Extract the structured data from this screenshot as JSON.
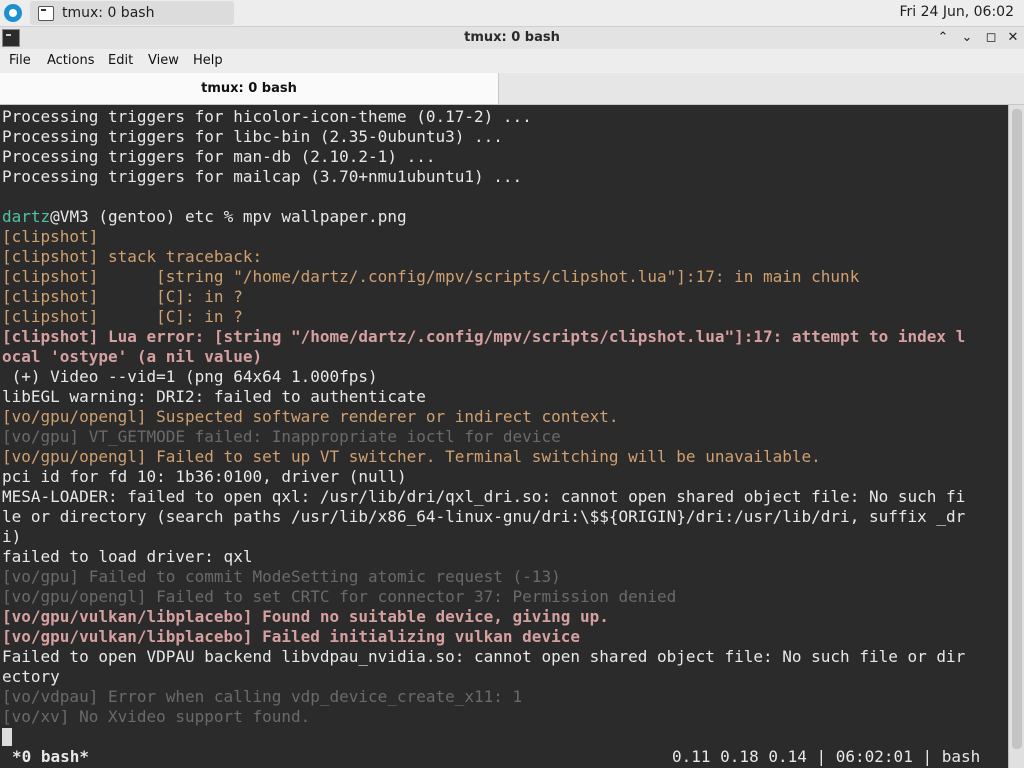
{
  "panel": {
    "task_label": "tmux: 0 bash",
    "clock": "Fri 24 Jun, 06:02"
  },
  "window": {
    "title": "tmux: 0 bash",
    "buttons": [
      "^",
      "v",
      "□",
      "×"
    ]
  },
  "menu": [
    "File",
    "Actions",
    "Edit",
    "View",
    "Help"
  ],
  "tab": {
    "label": "tmux: 0 bash"
  },
  "terminal": {
    "lines": [
      {
        "text": "Processing triggers for hicolor-icon-theme (0.17-2) ...",
        "style": "normal"
      },
      {
        "text": "Processing triggers for libc-bin (2.35-0ubuntu3) ...",
        "style": "normal"
      },
      {
        "text": "Processing triggers for man-db (2.10.2-1) ...",
        "style": "normal"
      },
      {
        "text": "Processing triggers for mailcap (3.70+nmu1ubuntu1) ...",
        "style": "normal"
      },
      {
        "text": "",
        "style": "normal"
      },
      {
        "prompt_user": "dartz",
        "text": "@VM3 (gentoo) etc % mpv wallpaper.png",
        "style": "prompt"
      },
      {
        "text": "[clipshot]",
        "style": "warn"
      },
      {
        "text": "[clipshot] stack traceback:",
        "style": "warn"
      },
      {
        "text": "[clipshot]      [string \"/home/dartz/.config/mpv/scripts/clipshot.lua\"]:17: in main chunk",
        "style": "warn"
      },
      {
        "text": "[clipshot]      [C]: in ?",
        "style": "warn"
      },
      {
        "text": "[clipshot]      [C]: in ?",
        "style": "warn"
      },
      {
        "text": "[clipshot] Lua error: [string \"/home/dartz/.config/mpv/scripts/clipshot.lua\"]:17: attempt to index l",
        "style": "err"
      },
      {
        "text": "ocal 'ostype' (a nil value)",
        "style": "err"
      },
      {
        "text": " (+) Video --vid=1 (png 64x64 1.000fps)",
        "style": "normal"
      },
      {
        "text": "libEGL warning: DRI2: failed to authenticate",
        "style": "normal"
      },
      {
        "text": "[vo/gpu/opengl] Suspected software renderer or indirect context.",
        "style": "warn"
      },
      {
        "text": "[vo/gpu] VT_GETMODE failed: Inappropriate ioctl for device",
        "style": "dim"
      },
      {
        "text": "[vo/gpu/opengl] Failed to set up VT switcher. Terminal switching will be unavailable.",
        "style": "warn"
      },
      {
        "text": "pci id for fd 10: 1b36:0100, driver (null)",
        "style": "normal"
      },
      {
        "text": "MESA-LOADER: failed to open qxl: /usr/lib/dri/qxl_dri.so: cannot open shared object file: No such fi",
        "style": "normal"
      },
      {
        "text": "le or directory (search paths /usr/lib/x86_64-linux-gnu/dri:\\$${ORIGIN}/dri:/usr/lib/dri, suffix _dr",
        "style": "normal"
      },
      {
        "text": "i)",
        "style": "normal"
      },
      {
        "text": "failed to load driver: qxl",
        "style": "normal"
      },
      {
        "text": "[vo/gpu] Failed to commit ModeSetting atomic request (-13)",
        "style": "dim"
      },
      {
        "text": "[vo/gpu/opengl] Failed to set CRTC for connector 37: Permission denied",
        "style": "dim"
      },
      {
        "text": "[vo/gpu/vulkan/libplacebo] Found no suitable device, giving up.",
        "style": "err"
      },
      {
        "text": "[vo/gpu/vulkan/libplacebo] Failed initializing vulkan device",
        "style": "err"
      },
      {
        "text": "Failed to open VDPAU backend libvdpau_nvidia.so: cannot open shared object file: No such file or dir",
        "style": "normal"
      },
      {
        "text": "ectory",
        "style": "normal"
      },
      {
        "text": "[vo/vdpau] Error when calling vdp_device_create_x11: 1",
        "style": "dim"
      },
      {
        "text": "[vo/xv] No Xvideo support found.",
        "style": "dim"
      }
    ]
  },
  "status": {
    "window": "*0 bash*",
    "right": "0.11 0.18 0.14 | 06:02:01 | bash"
  }
}
